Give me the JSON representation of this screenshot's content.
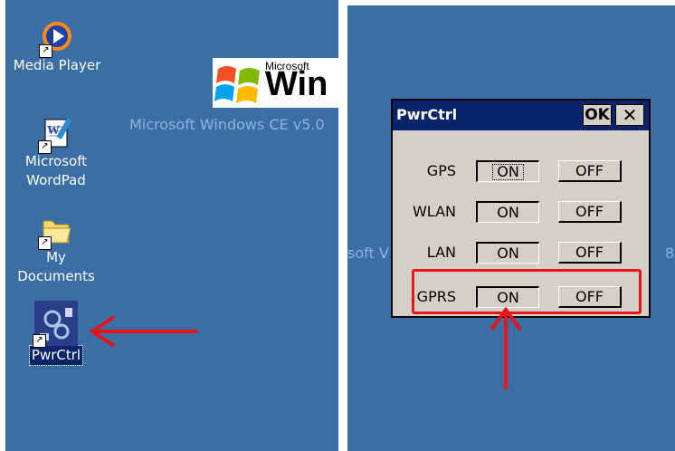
{
  "left_desktop": {
    "icons": [
      {
        "label": "Media Player"
      },
      {
        "label": "Microsoft WordPad"
      },
      {
        "label": "My Documents"
      },
      {
        "label": "PwrCtrl"
      }
    ],
    "banner_logo_text_small": "Microsoft",
    "banner_logo_text_big": "Win",
    "watermark": "Microsoft Windows CE v5.0"
  },
  "right_desktop": {
    "watermark_left": "soft V",
    "watermark_right": "8",
    "dialog": {
      "title": "PwrCtrl",
      "ok_label": "OK",
      "close_label": "✕",
      "rows": [
        {
          "name": "GPS",
          "on": "ON",
          "off": "OFF"
        },
        {
          "name": "WLAN",
          "on": "ON",
          "off": "OFF"
        },
        {
          "name": "LAN",
          "on": "ON",
          "off": "OFF"
        },
        {
          "name": "GPRS",
          "on": "ON",
          "off": "OFF"
        }
      ]
    }
  },
  "colors": {
    "desktop": "#3a6ea5",
    "annotation_red": "#e8141c",
    "dialog_face": "#d4d0c8",
    "titlebar": "#0a246a"
  }
}
